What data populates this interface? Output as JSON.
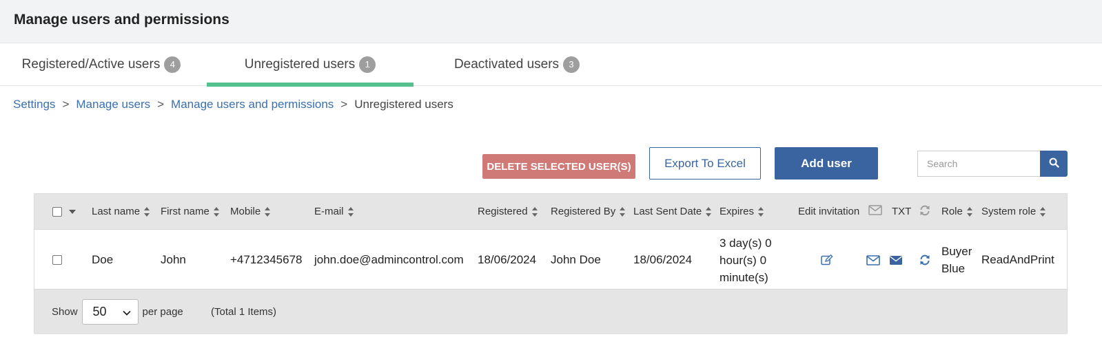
{
  "page": {
    "title": "Manage users and permissions"
  },
  "tabs": [
    {
      "label": "Registered/Active users",
      "count": "4",
      "active": false
    },
    {
      "label": "Unregistered users",
      "count": "1",
      "active": true
    },
    {
      "label": "Deactivated users",
      "count": "3",
      "active": false
    }
  ],
  "breadcrumb": {
    "items": [
      "Settings",
      "Manage users",
      "Manage users and permissions"
    ],
    "current": "Unregistered users",
    "separator": ">"
  },
  "toolbar": {
    "delete_label": "DELETE SELECTED USER(S)",
    "export_label": "Export To Excel",
    "add_label": "Add user",
    "search_placeholder": "Search"
  },
  "table": {
    "columns": {
      "last_name": "Last name",
      "first_name": "First name",
      "mobile": "Mobile",
      "email": "E-mail",
      "registered": "Registered",
      "registered_by": "Registered By",
      "last_sent_date": "Last Sent Date",
      "expires": "Expires",
      "edit_invitation": "Edit invitation",
      "txt": "TXT",
      "role": "Role",
      "system_role": "System role"
    },
    "rows": [
      {
        "last_name": "Doe",
        "first_name": "John",
        "mobile": "+4712345678",
        "email": "john.doe@admincontrol.com",
        "registered": "18/06/2024",
        "registered_by": "John Doe",
        "last_sent_date": "18/06/2024",
        "expires_line1": "3 day(s) 0",
        "expires_line2": "hour(s) 0",
        "expires_line3": "minute(s)",
        "role_line1": "Buyer",
        "role_line2": "Blue",
        "system_role": "ReadAndPrint"
      }
    ]
  },
  "footer": {
    "show_label": "Show",
    "page_size": "50",
    "per_page_label": "per page",
    "total_label": "(Total 1 Items)"
  },
  "colors": {
    "accent": "#3a64a0",
    "active_tab": "#55c28e",
    "delete": "#d07a78",
    "link": "#3a6fb0"
  }
}
